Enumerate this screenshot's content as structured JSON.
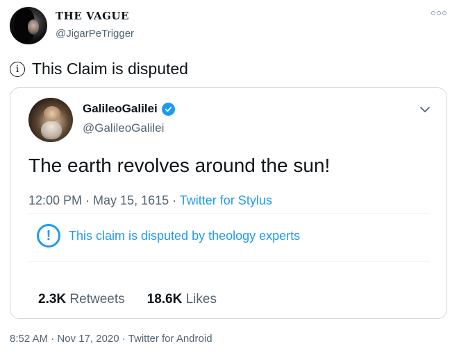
{
  "author": {
    "display_name": "THE VAGUE",
    "handle": "@JigarPeTrigger"
  },
  "notice": {
    "text": "This Claim is disputed",
    "icon": "info-icon"
  },
  "quoted": {
    "display_name": "GalileoGalilei",
    "handle": "@GalileoGalilei",
    "text": "The earth revolves around the sun!",
    "time": "12:00 PM · May 15, 1615 · ",
    "source": "Twitter for Stylus",
    "dispute_text": "This claim is disputed by theology experts",
    "retweets_count": "2.3K",
    "retweets_label": "Retweets",
    "likes_count": "18.6K",
    "likes_label": "Likes"
  },
  "footer": {
    "timestamp": "8:52 AM · Nov 17, 2020 · Twitter for Android"
  },
  "colors": {
    "accent": "#1d9bf0",
    "secondary_text": "#536471",
    "border": "#cfd9de"
  }
}
